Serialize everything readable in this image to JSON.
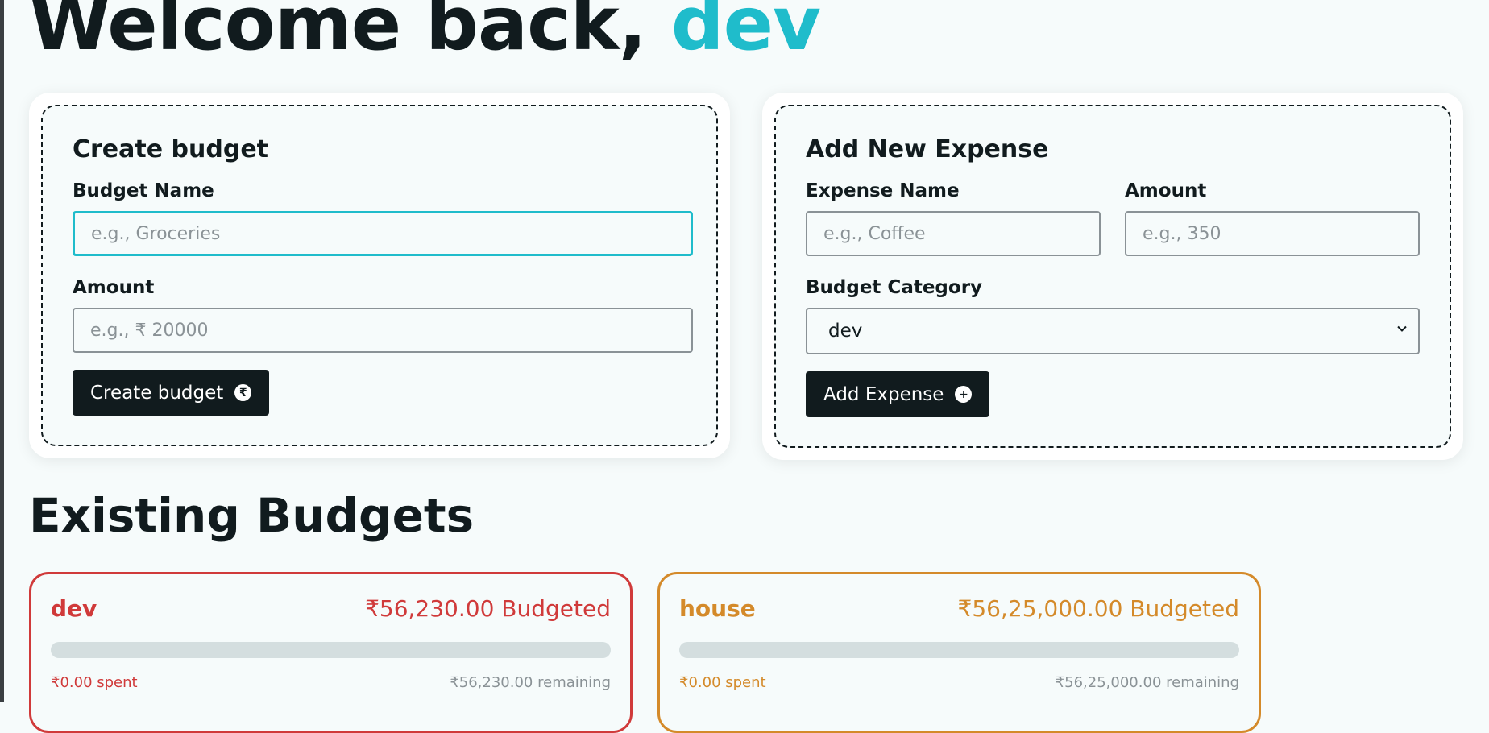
{
  "header": {
    "welcome_prefix": "Welcome back, ",
    "username": "dev"
  },
  "create_budget": {
    "title": "Create budget",
    "name_label": "Budget Name",
    "name_placeholder": "e.g., Groceries",
    "amount_label": "Amount",
    "amount_placeholder": "e.g., ₹ 20000",
    "button_label": "Create budget",
    "button_icon": "rupee-circle-icon"
  },
  "add_expense": {
    "title": "Add New Expense",
    "name_label": "Expense Name",
    "name_placeholder": "e.g., Coffee",
    "amount_label": "Amount",
    "amount_placeholder": "e.g., 350",
    "category_label": "Budget Category",
    "category_selected": "dev",
    "button_label": "Add Expense",
    "button_icon": "plus-circle-icon"
  },
  "existing": {
    "title": "Existing Budgets",
    "budgets": [
      {
        "name": "dev",
        "budgeted": "₹56,230.00 Budgeted",
        "spent": "₹0.00 spent",
        "remaining": "₹56,230.00 remaining",
        "progress": 0,
        "color": "#d03a3a"
      },
      {
        "name": "house",
        "budgeted": "₹56,25,000.00 Budgeted",
        "spent": "₹0.00 spent",
        "remaining": "₹56,25,000.00 remaining",
        "progress": 0,
        "color": "#d48a2a"
      }
    ]
  },
  "colors": {
    "accent": "#1fbccb",
    "dark": "#111b1e",
    "background": "#f6fbfb"
  }
}
